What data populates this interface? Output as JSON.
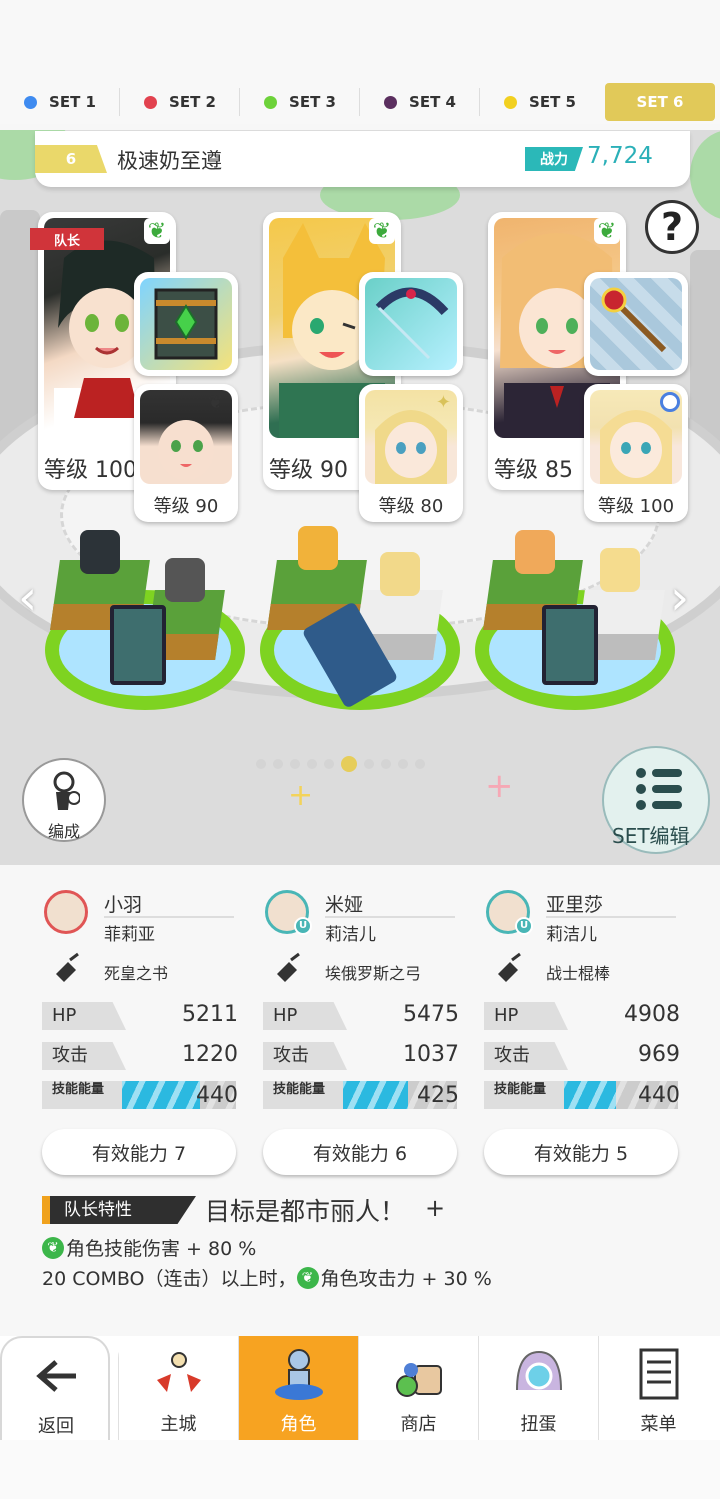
{
  "set_tabs": [
    {
      "label": "SET 1",
      "color": "#3f8bf0",
      "active": false
    },
    {
      "label": "SET 2",
      "color": "#e2424f",
      "active": false
    },
    {
      "label": "SET 3",
      "color": "#6dd23a",
      "active": false
    },
    {
      "label": "SET 4",
      "color": "#5b2f5f",
      "active": false
    },
    {
      "label": "SET 5",
      "color": "#f2d020",
      "active": false
    },
    {
      "label": "SET 6",
      "color": "",
      "active": true
    }
  ],
  "team": {
    "number": "6",
    "name": "极速奶至遵",
    "power_label": "战力",
    "power_value": "7,724"
  },
  "help_icon": "?",
  "leader_tag": "队长",
  "cards": [
    {
      "level": "等级 100",
      "sub_level": "等级 90",
      "weapon_icon": "green-book-icon"
    },
    {
      "level": "等级 90",
      "sub_level": "等级 80",
      "weapon_icon": "bow-icon"
    },
    {
      "level": "等级 85",
      "sub_level": "等级 100",
      "weapon_icon": "staff-icon"
    }
  ],
  "page_dots": {
    "count": 10,
    "active_index": 5
  },
  "edit_button": "编成",
  "set_edit_button": "SET编辑",
  "stat_labels": {
    "hp": "HP",
    "atk": "攻击",
    "energy": "技能能量"
  },
  "members": [
    {
      "name": "小羽",
      "sub": "菲莉亚",
      "weapon": "死皇之书",
      "hp": "5211",
      "atk": "1220",
      "energy": "440",
      "energy_fill": 0.72,
      "ability": "有效能力 7"
    },
    {
      "name": "米娅",
      "sub": "莉洁儿",
      "weapon": "埃俄罗斯之弓",
      "hp": "5475",
      "atk": "1037",
      "energy": "425",
      "energy_fill": 0.62,
      "ability": "有效能力 6"
    },
    {
      "name": "亚里莎",
      "sub": "莉洁儿",
      "weapon": "战士棍棒",
      "hp": "4908",
      "atk": "969",
      "energy": "440",
      "energy_fill": 0.52,
      "ability": "有效能力 5"
    }
  ],
  "leader_skill": {
    "label": "队长特性",
    "title": "目标是都市丽人！",
    "plus": "+",
    "effect1": "角色技能伤害 + 80 %",
    "effect2_prefix": "20 COMBO（连击）以上时，",
    "effect2": "角色攻击力 + 30 %"
  },
  "nav": [
    {
      "label": "返回",
      "icon": "back-arrow-icon"
    },
    {
      "label": "主城",
      "icon": "castle-icon"
    },
    {
      "label": "角色",
      "icon": "character-icon",
      "active": true
    },
    {
      "label": "商店",
      "icon": "shop-icon"
    },
    {
      "label": "扭蛋",
      "icon": "gacha-icon"
    },
    {
      "label": "菜单",
      "icon": "menu-icon"
    }
  ]
}
